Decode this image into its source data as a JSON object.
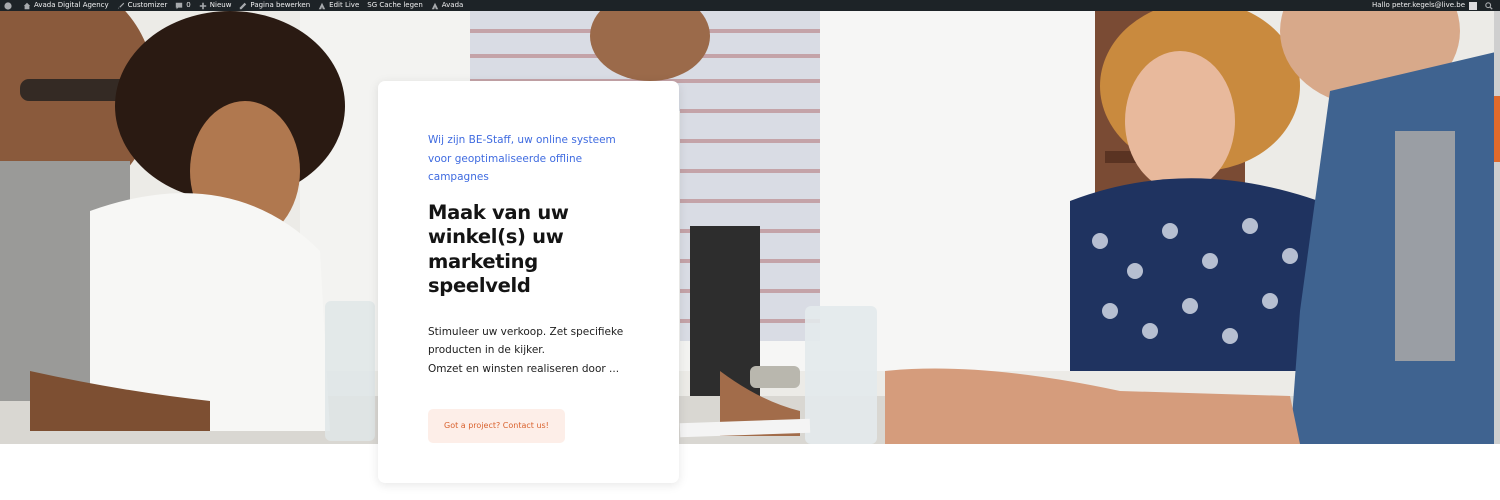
{
  "adminbar": {
    "items": [
      {
        "label": "",
        "icon": "wordpress-icon"
      },
      {
        "label": "Avada Digital Agency",
        "icon": "home-icon"
      },
      {
        "label": "Customizer",
        "icon": "brush-icon"
      },
      {
        "label": "0",
        "icon": "comment-icon"
      },
      {
        "label": "Nieuw",
        "icon": "plus-icon"
      },
      {
        "label": "Pagina bewerken",
        "icon": "pencil-icon"
      },
      {
        "label": "Edit Live",
        "icon": "avada-icon"
      },
      {
        "label": "SG Cache legen",
        "icon": ""
      },
      {
        "label": "Avada",
        "icon": "avada-icon"
      }
    ],
    "greeting": "Hallo peter.kegels@live.be",
    "search_icon": "search-icon"
  },
  "card": {
    "eyebrow": "Wij zijn BE-Staff, uw online systeem voor geoptimaliseerde offline campagnes",
    "heading": "Maak van uw winkel(s) uw marketing speelveld",
    "body_line1": "Stimuleer uw verkoop. Zet specifieke producten in de kijker.",
    "body_line2": "Omzet en winsten realiseren door ...",
    "cta_label": "Got a project? Contact us!"
  },
  "colors": {
    "accent_blue": "#3f6be0",
    "cta_text": "#d9622e",
    "cta_bg": "#fdeee8",
    "adminbar_bg": "#1d2327"
  }
}
